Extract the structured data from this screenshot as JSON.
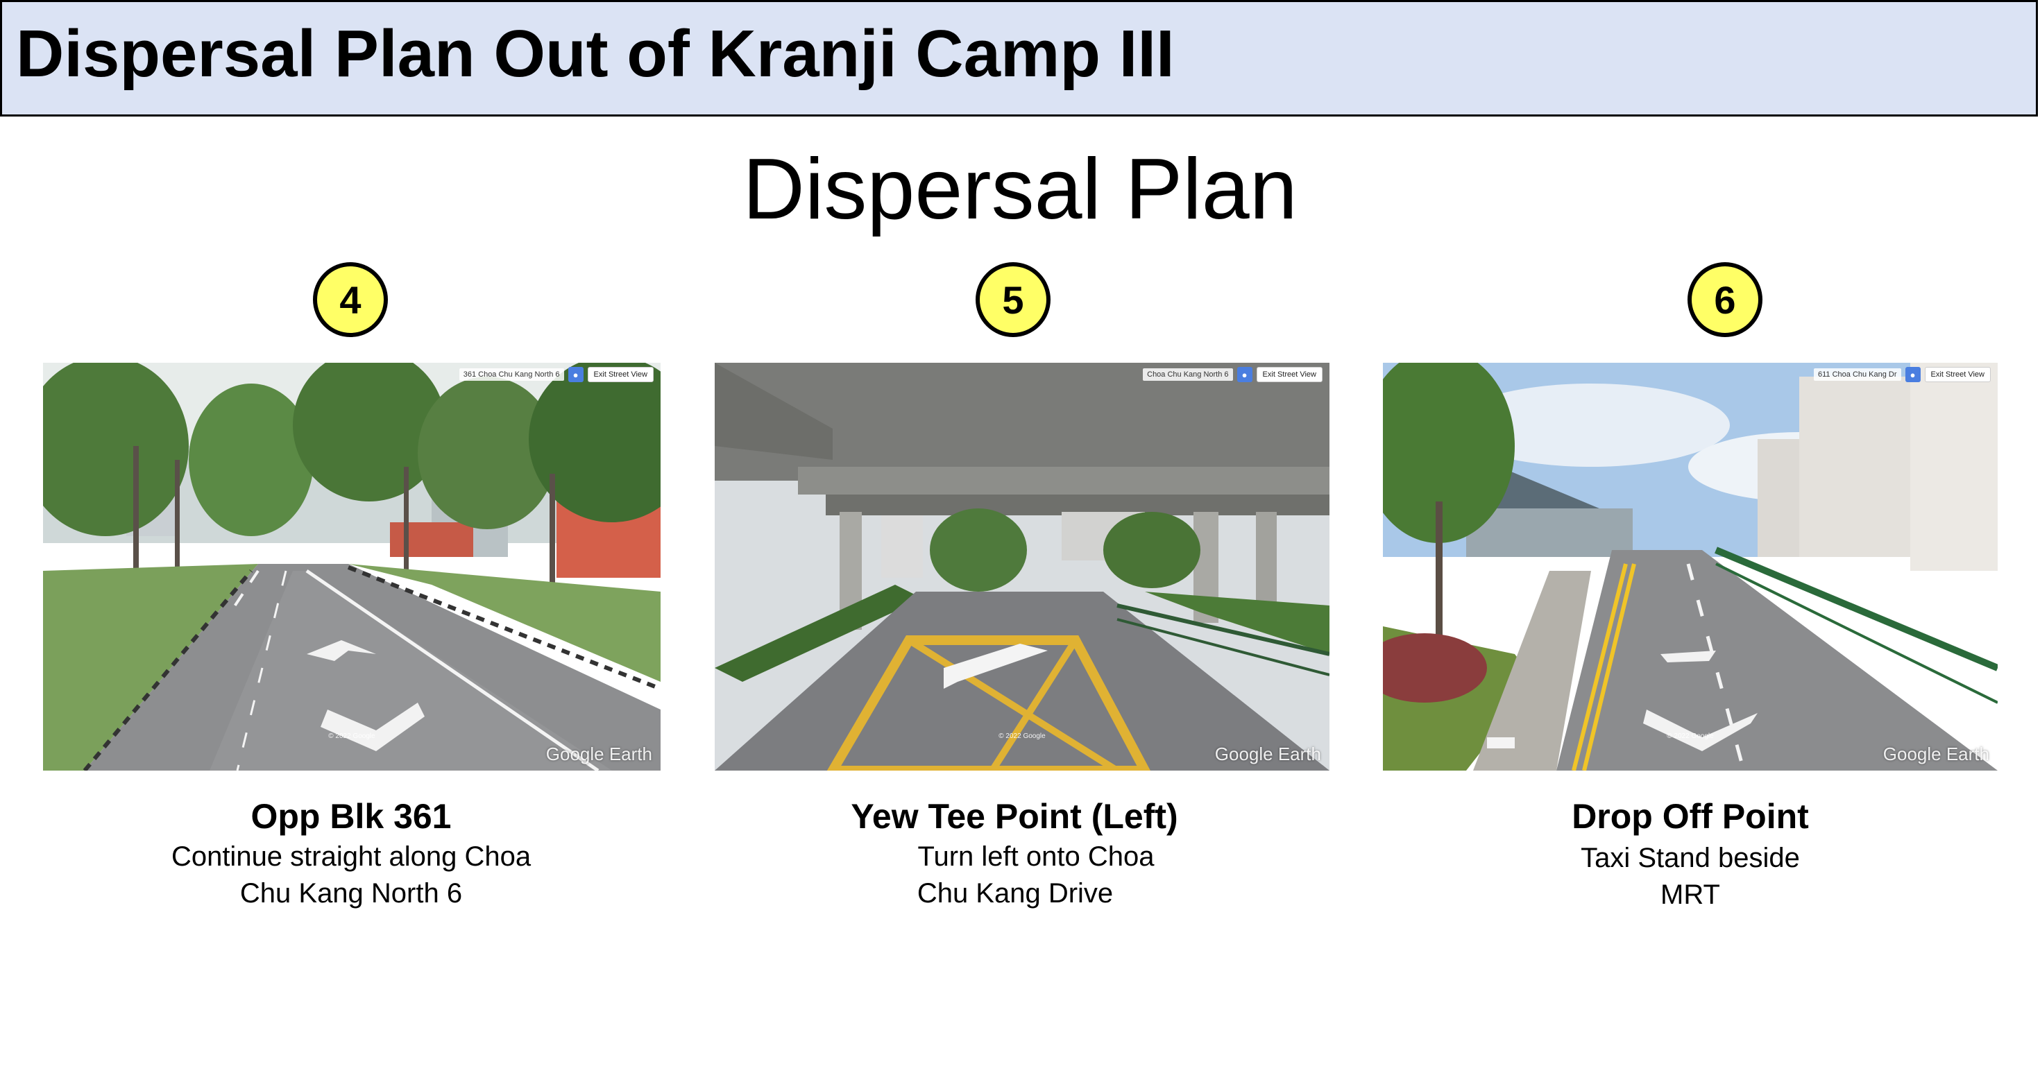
{
  "header": {
    "title": "Dispersal Plan Out of Kranji Camp III"
  },
  "page_title": "Dispersal Plan",
  "steps": [
    {
      "number": "4",
      "title": "Opp Blk 361",
      "line1": "Continue straight along Choa",
      "line2": "Chu Kang North 6",
      "street_label": "361 Choa Chu Kang North 6",
      "exit_label": "Exit Street View",
      "watermark": "Google Earth",
      "copyright": "© 2022 Google"
    },
    {
      "number": "5",
      "title": "Yew Tee Point (Left)",
      "line1": "Turn left onto Choa",
      "line2": "Chu Kang Drive",
      "street_label": "Choa Chu Kang North 6",
      "exit_label": "Exit Street View",
      "watermark": "Google Earth",
      "copyright": "© 2022 Google"
    },
    {
      "number": "6",
      "title": "Drop Off Point",
      "line1": "Taxi Stand beside",
      "line2": "MRT",
      "street_label": "611 Choa Chu Kang Dr",
      "exit_label": "Exit Street View",
      "watermark": "Google Earth",
      "copyright": "© 2022 Google"
    }
  ],
  "colors": {
    "header_background": "#dbe3f4",
    "badge_fill": "#ffff66"
  }
}
